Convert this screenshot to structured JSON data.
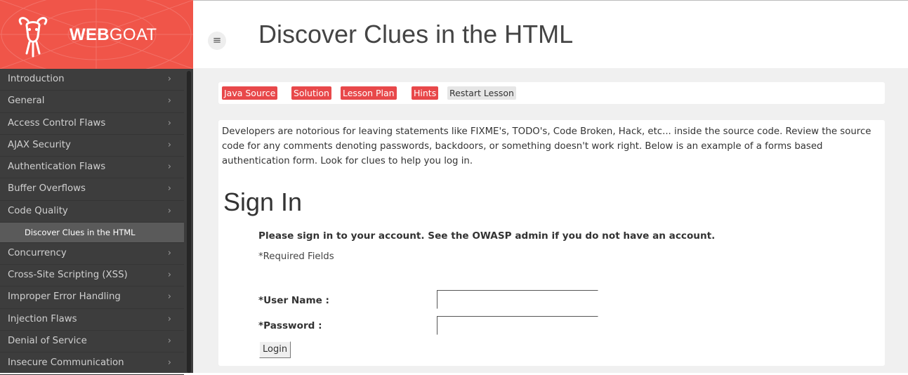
{
  "logo": {
    "text_bold": "WEB",
    "text_light": "GOAT",
    "icon": "goat-icon"
  },
  "sidebar": {
    "items": [
      {
        "label": "Introduction",
        "icon": "chevron-right-icon"
      },
      {
        "label": "General",
        "icon": "chevron-right-icon"
      },
      {
        "label": "Access Control Flaws",
        "icon": "chevron-right-icon"
      },
      {
        "label": "AJAX Security",
        "icon": "chevron-right-icon"
      },
      {
        "label": "Authentication Flaws",
        "icon": "chevron-right-icon"
      },
      {
        "label": "Buffer Overflows",
        "icon": "chevron-right-icon"
      },
      {
        "label": "Code Quality",
        "icon": "chevron-right-icon"
      },
      {
        "label": "Concurrency",
        "icon": "chevron-right-icon"
      },
      {
        "label": "Cross-Site Scripting (XSS)",
        "icon": "chevron-right-icon"
      },
      {
        "label": "Improper Error Handling",
        "icon": "chevron-right-icon"
      },
      {
        "label": "Injection Flaws",
        "icon": "chevron-right-icon"
      },
      {
        "label": "Denial of Service",
        "icon": "chevron-right-icon"
      },
      {
        "label": "Insecure Communication",
        "icon": "chevron-right-icon"
      }
    ],
    "active_subitem": "Discover Clues in the HTML",
    "chevron": "›"
  },
  "header": {
    "menu_toggle_icon": "≡",
    "title": "Discover Clues in the HTML"
  },
  "lesson_buttons": {
    "java_source": "Java Source",
    "solution": "Solution",
    "lesson_plan": "Lesson Plan",
    "hints": "Hints",
    "restart": "Restart Lesson"
  },
  "content": {
    "description": "Developers are notorious for leaving statements like FIXME's, TODO's, Code Broken, Hack, etc... inside the source code.  Review the source code for any comments denoting  passwords, backdoors, or something doesn't work right.  Below is an example of a forms based authentication form. Look for clues to help you log in.",
    "signin_title": "Sign In",
    "signin_message": "Please sign in to your account. See the OWASP admin if you do not have an account.",
    "required_note": "*Required Fields",
    "username_label": "*User Name :",
    "username_value": "",
    "password_label": "*Password :",
    "password_value": "",
    "login_button": "Login"
  },
  "colors": {
    "brand_red": "#f05549",
    "button_red": "#e8484a",
    "sidebar_bg": "#3d3d3d",
    "active_item_bg": "#5a5a5a"
  }
}
